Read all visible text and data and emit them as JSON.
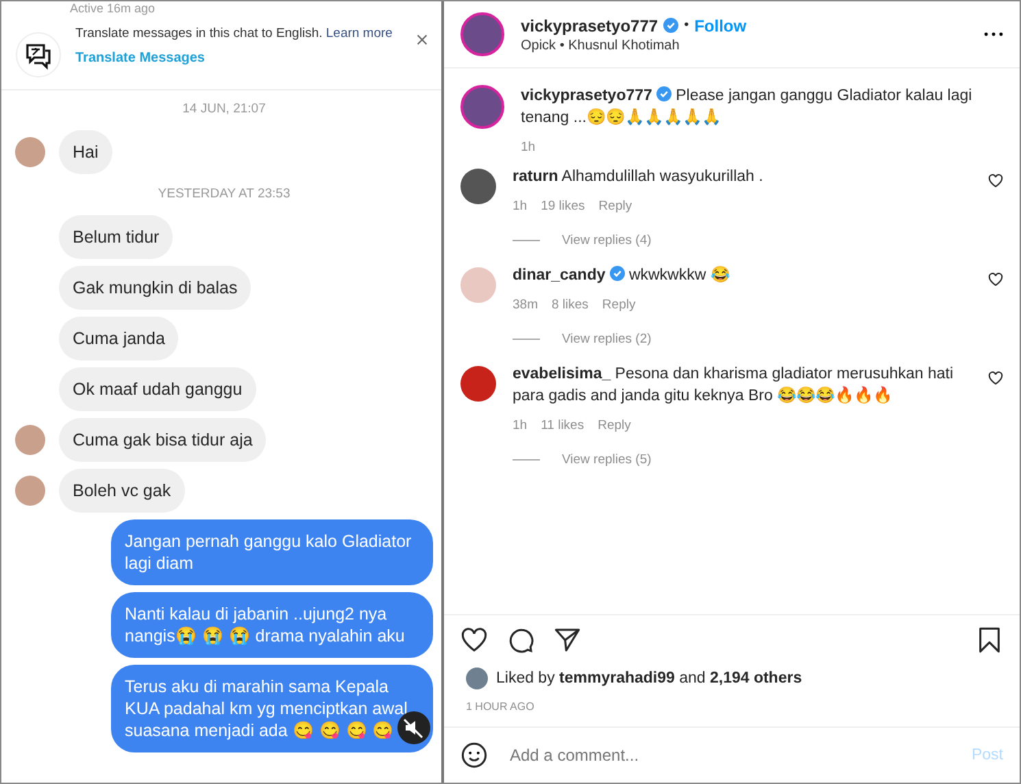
{
  "chat": {
    "status": "Active 16m ago",
    "translate_banner": {
      "text": "Translate messages in this chat to English.",
      "link": "Learn more",
      "action": "Translate Messages"
    },
    "items": [
      {
        "kind": "date",
        "text": "14 JUN, 21:07"
      },
      {
        "kind": "received",
        "text": "Hai",
        "avatar": true
      },
      {
        "kind": "date",
        "text": "YESTERDAY AT 23:53"
      },
      {
        "kind": "received",
        "text": "Belum tidur",
        "avatar": false
      },
      {
        "kind": "received",
        "text": "Gak mungkin di balas",
        "avatar": false
      },
      {
        "kind": "received",
        "text": "Cuma janda",
        "avatar": false
      },
      {
        "kind": "received",
        "text": "Ok maaf udah ganggu",
        "avatar": false
      },
      {
        "kind": "received",
        "text": "Cuma gak bisa tidur aja",
        "avatar": true
      },
      {
        "kind": "received",
        "text": "Boleh vc gak",
        "avatar": true
      },
      {
        "kind": "sent",
        "text": "Jangan pernah ganggu kalo Gladiator lagi diam"
      },
      {
        "kind": "sent",
        "text": "Nanti kalau di jabanin ..ujung2 nya nangis😭 😭 😭 drama nyalahin aku"
      },
      {
        "kind": "sent",
        "text": "Terus aku di marahin sama Kepala KUA padahal km yg menciptkan awal suasana menjadi ada 😋 😋 😋 😋"
      }
    ]
  },
  "post": {
    "username": "vickyprasetyo777",
    "verified": true,
    "separator": "•",
    "follow": "Follow",
    "audio": "Opick • Khusnul Khotimah",
    "caption": {
      "username": "vickyprasetyo777",
      "verified": true,
      "text": "Please jangan ganggu Gladiator kalau lagi tenang ...😔😔🙏🙏🙏🙏🙏",
      "time": "1h"
    },
    "comments": [
      {
        "username": "raturn",
        "verified": false,
        "text": "Alhamdulillah wasyukurillah .",
        "time": "1h",
        "likes": "19 likes",
        "reply": "Reply",
        "view_replies": "View replies (4)"
      },
      {
        "username": "dinar_candy",
        "verified": true,
        "text": "wkwkwkkw 😂",
        "time": "38m",
        "likes": "8 likes",
        "reply": "Reply",
        "view_replies": "View replies (2)"
      },
      {
        "username": "evabelisima_",
        "verified": false,
        "text": "Pesona dan kharisma gladiator merusuhkan hati para gadis and janda gitu keknya Bro 😂😂😂🔥🔥🔥",
        "time": "1h",
        "likes": "11 likes",
        "reply": "Reply",
        "view_replies": "View replies (5)"
      }
    ],
    "liked_by": "Liked by **temmyrahadi99** and **2,194 others**",
    "timestamp": "1 HOUR AGO",
    "comment_field": {
      "placeholder": "Add a comment..."
    },
    "post_button": "Post"
  }
}
